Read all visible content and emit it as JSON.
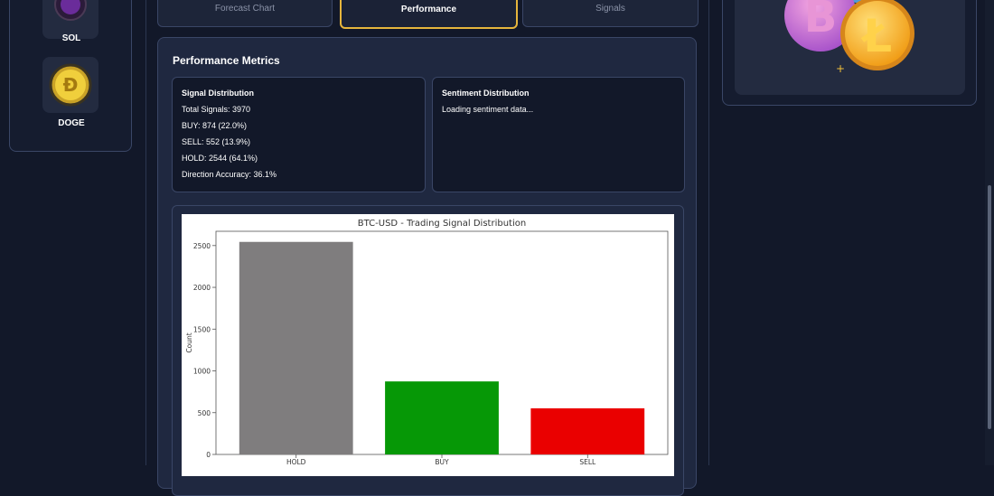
{
  "sidebar": {
    "coins": [
      {
        "label": "SOL"
      },
      {
        "label": "DOGE"
      }
    ]
  },
  "tabs": [
    {
      "label": "Forecast Chart"
    },
    {
      "label": "Performance"
    },
    {
      "label": "Signals"
    }
  ],
  "main": {
    "title": "Performance Metrics",
    "signal_card": {
      "heading": "Signal Distribution",
      "lines": [
        "Total Signals: 3970",
        "BUY: 874 (22.0%)",
        "SELL: 552 (13.9%)",
        "HOLD: 2544 (64.1%)",
        "Direction Accuracy: 36.1%"
      ]
    },
    "sentiment_card": {
      "heading": "Sentiment Distribution",
      "status": "Loading sentiment data..."
    }
  },
  "chart_data": {
    "type": "bar",
    "title": "BTC-USD - Trading Signal Distribution",
    "ylabel": "Count",
    "xlabel": "",
    "categories": [
      "HOLD",
      "BUY",
      "SELL"
    ],
    "values": [
      2544,
      874,
      552
    ],
    "colors": [
      "#7f7d7e",
      "#069806",
      "#ea0000"
    ],
    "ylim": [
      0,
      2671
    ],
    "yticks": [
      0,
      500,
      1000,
      1500,
      2000,
      2500
    ],
    "grid": false
  },
  "icons": {
    "sol": "solana-coin-icon",
    "doge": "dogecoin-icon",
    "crypto": "crypto-coins-illustration"
  },
  "colors": {
    "accent": "#e6b53c",
    "background": "#121829",
    "panel": "#1f2840"
  }
}
